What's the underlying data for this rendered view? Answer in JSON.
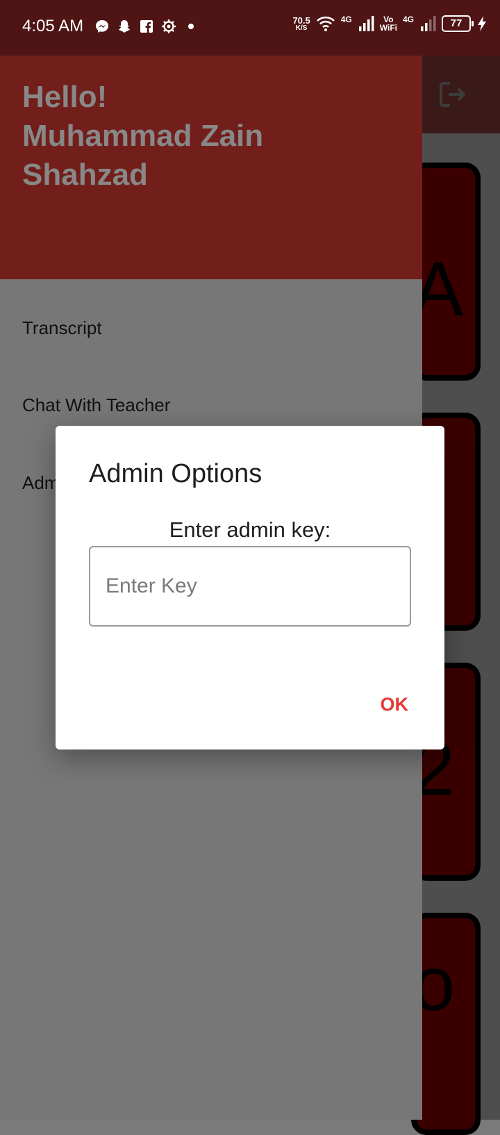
{
  "status_bar": {
    "time": "4:05 AM",
    "net_speed_value": "70.5",
    "net_speed_unit": "K/S",
    "network_1": "4G",
    "vowifi_top": "Vo",
    "vowifi_bottom": "WiFi",
    "network_2": "4G",
    "battery": "77",
    "icons": [
      "messenger-icon",
      "snapchat-icon",
      "facebook-icon",
      "settings-icon",
      "dot-icon",
      "wifi-icon",
      "signal-icon",
      "charging-icon"
    ]
  },
  "drawer": {
    "greeting_line1": "Hello!",
    "greeting_line2": "Muhammad Zain",
    "greeting_line3": "Shahzad",
    "items": [
      {
        "label": "Transcript"
      },
      {
        "label": "Chat With Teacher"
      },
      {
        "label": "Adm"
      }
    ]
  },
  "background": {
    "cards": [
      {
        "text": "A"
      },
      {
        "text": ""
      },
      {
        "text": "2"
      },
      {
        "text": "o"
      }
    ]
  },
  "dialog": {
    "title": "Admin Options",
    "label": "Enter admin key:",
    "input_placeholder": "Enter Key",
    "input_value": "",
    "ok_label": "OK"
  },
  "colors": {
    "app_bar": "#3a1a19",
    "drawer_header": "#721f1c",
    "drawer_body": "#777777",
    "card_fill": "#3a0000",
    "accent": "#e53935"
  }
}
